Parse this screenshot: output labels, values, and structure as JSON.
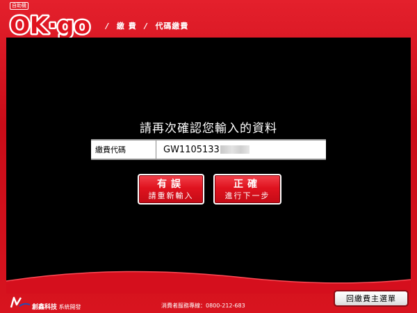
{
  "brand": {
    "logo_text": "OK·go",
    "logo_small": "自助機"
  },
  "breadcrumb": {
    "sep1": "/",
    "item1": "繳 費",
    "sep2": "/",
    "item2": "代碼繳費"
  },
  "main": {
    "prompt": "請再次確認您輸入的資料",
    "field_label": "繳費代碼",
    "field_value": "GW1105133"
  },
  "buttons": {
    "retry_big": "有誤",
    "retry_small": "請重新輸入",
    "confirm_big": "正確",
    "confirm_small": "進行下一步",
    "main_menu": "回繳費主選單"
  },
  "footer": {
    "company": "創鑫科技",
    "company_suffix": "系統開發",
    "hotline": "消費者服務專線：0800-212-683"
  },
  "colors": {
    "brand_red": "#d50f1d",
    "screen_bg": "#000000"
  }
}
